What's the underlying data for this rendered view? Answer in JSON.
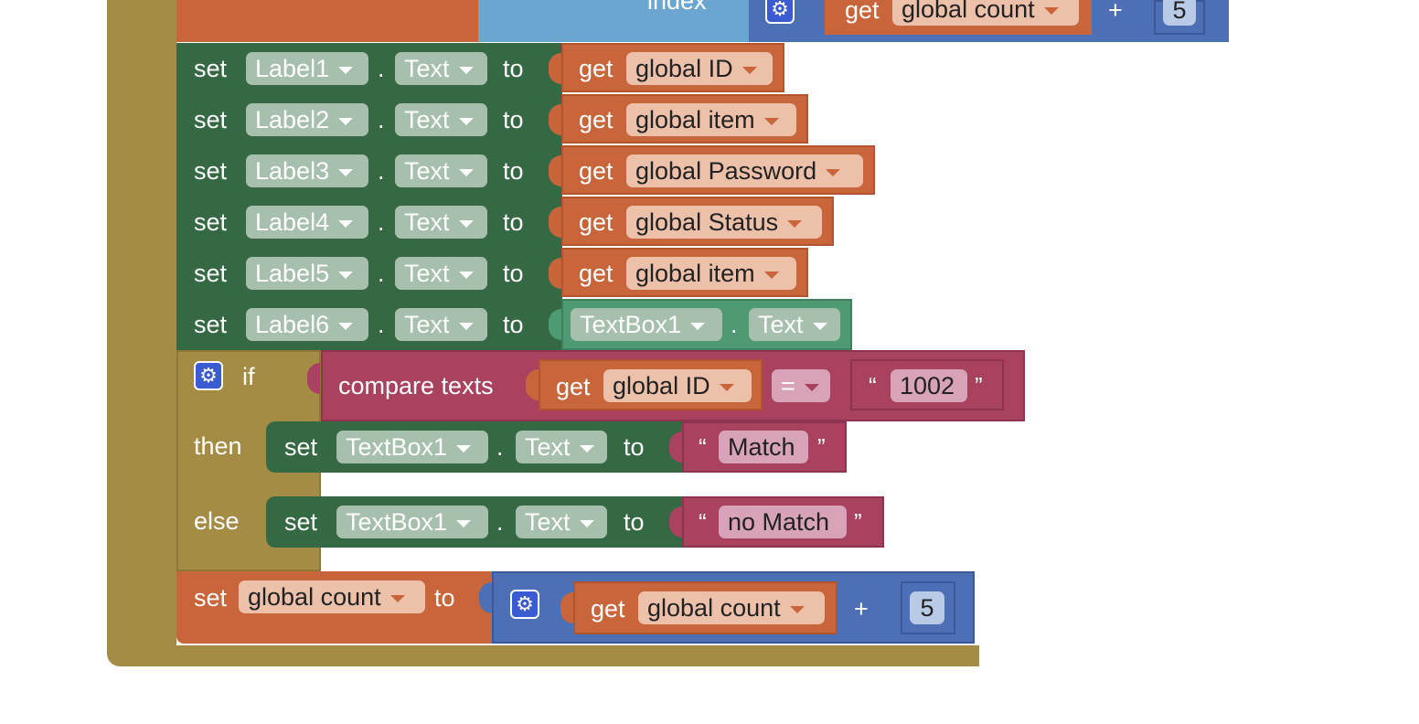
{
  "top_partial": {
    "index_label": "index",
    "get_label": "get",
    "var": "global count",
    "plus": "+",
    "number": "5"
  },
  "set_rows": [
    {
      "set": "set",
      "component": "Label1",
      "dot": ".",
      "property": "Text",
      "to": "to",
      "get": "get",
      "value": "global ID"
    },
    {
      "set": "set",
      "component": "Label2",
      "dot": ".",
      "property": "Text",
      "to": "to",
      "get": "get",
      "value": "global item"
    },
    {
      "set": "set",
      "component": "Label3",
      "dot": ".",
      "property": "Text",
      "to": "to",
      "get": "get",
      "value": "global Password"
    },
    {
      "set": "set",
      "component": "Label4",
      "dot": ".",
      "property": "Text",
      "to": "to",
      "get": "get",
      "value": "global Status"
    },
    {
      "set": "set",
      "component": "Label5",
      "dot": ".",
      "property": "Text",
      "to": "to",
      "get": "get",
      "value": "global item"
    }
  ],
  "label6_row": {
    "set": "set",
    "component": "Label6",
    "dot": ".",
    "property": "Text",
    "to": "to",
    "source_component": "TextBox1",
    "source_dot": ".",
    "source_property": "Text"
  },
  "if_block": {
    "if": "if",
    "then": "then",
    "else": "else",
    "compare": "compare texts",
    "get": "get",
    "var": "global ID",
    "operator": "=",
    "open_quote": "“",
    "close_quote": "”",
    "literal": "1002",
    "then_stmt": {
      "set": "set",
      "component": "TextBox1",
      "dot": ".",
      "property": "Text",
      "to": "to",
      "value": "Match"
    },
    "else_stmt": {
      "set": "set",
      "component": "TextBox1",
      "dot": ".",
      "property": "Text",
      "to": "to",
      "value": "no Match"
    }
  },
  "count_row": {
    "set": "set",
    "var": "global count",
    "to": "to",
    "get": "get",
    "get_var": "global count",
    "plus": "+",
    "number": "5"
  },
  "colors": {
    "control": "#a58c44",
    "component_set": "#356944",
    "variable": "#c9653a",
    "math": "#4c6fb5",
    "text": "#a8425f",
    "component_get": "#4e9a73",
    "list": "#6aa6d0"
  }
}
